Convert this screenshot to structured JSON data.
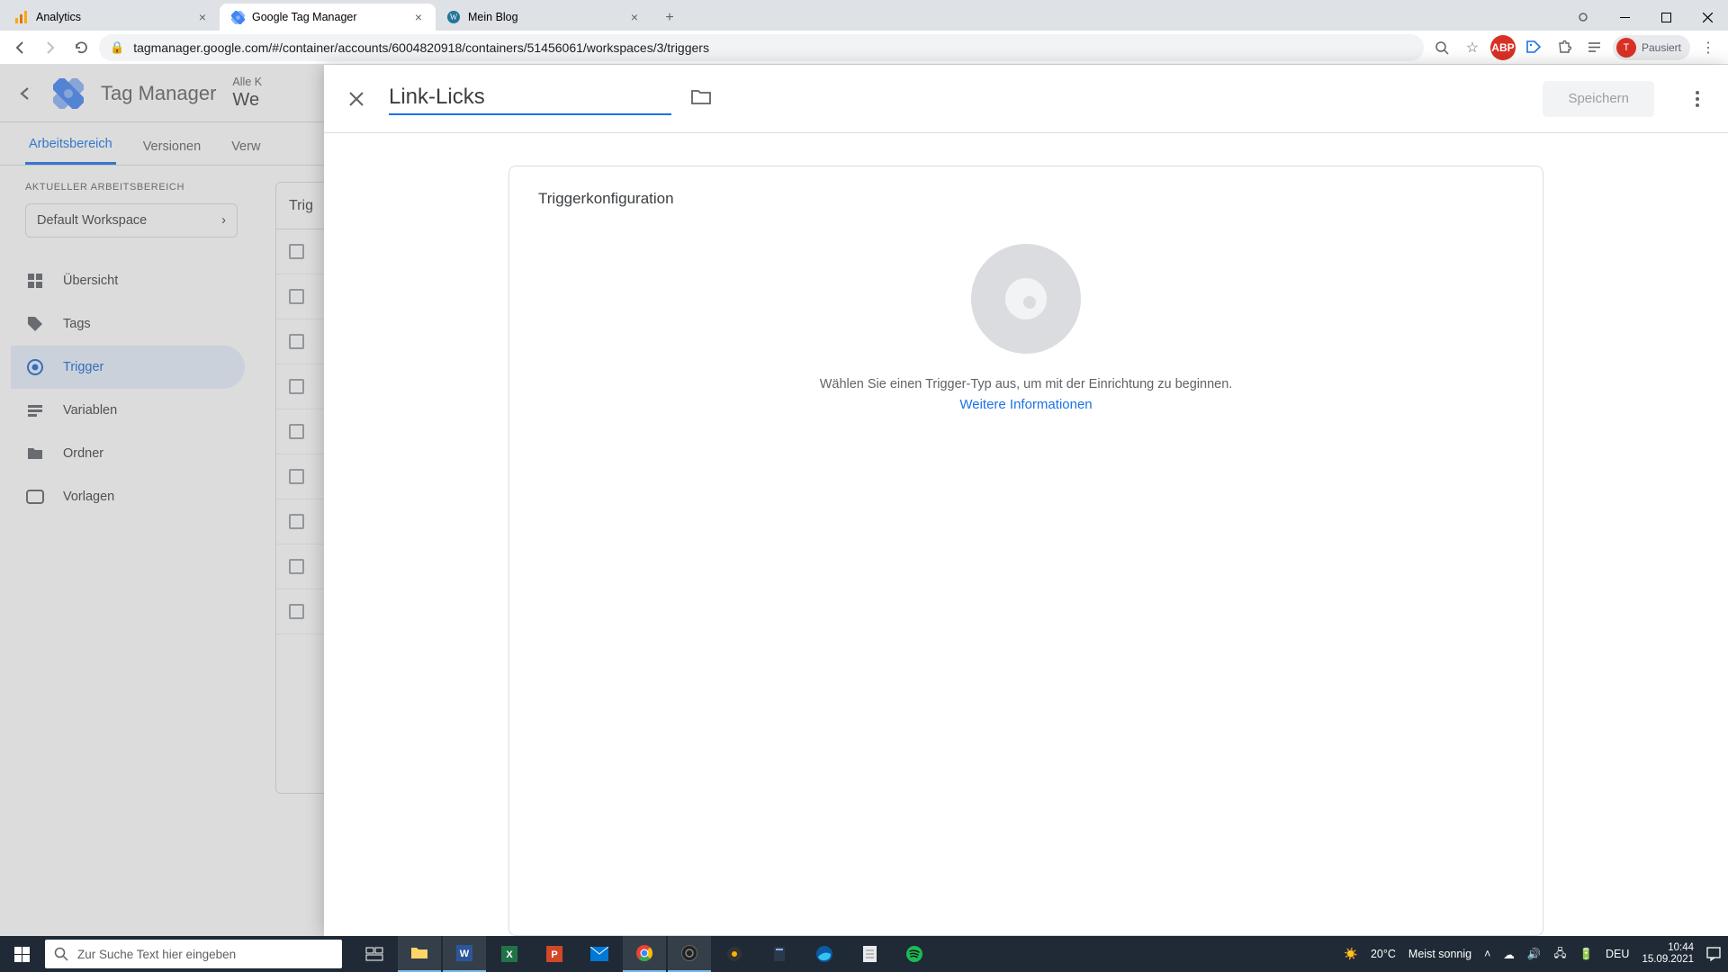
{
  "browser": {
    "tabs": [
      {
        "label": "Analytics",
        "favicon": "analytics"
      },
      {
        "label": "Google Tag Manager",
        "favicon": "gtm",
        "active": true
      },
      {
        "label": "Mein Blog",
        "favicon": "wordpress"
      }
    ],
    "url": "tagmanager.google.com/#/container/accounts/6004820918/containers/51456061/workspaces/3/triggers",
    "profile_status": "Pausiert",
    "profile_initial": "T"
  },
  "gtm": {
    "app_name": "Tag Manager",
    "crumb1": "Alle K",
    "crumb2": "We",
    "tabs": {
      "workspace": "Arbeitsbereich",
      "versions": "Versionen",
      "admin": "Verw"
    },
    "ws_label": "AKTUELLER ARBEITSBEREICH",
    "ws_name": "Default Workspace",
    "nav": {
      "overview": "Übersicht",
      "tags": "Tags",
      "trigger": "Trigger",
      "variables": "Variablen",
      "folders": "Ordner",
      "templates": "Vorlagen"
    },
    "table_head": "Trig"
  },
  "panel": {
    "title_value": "Link-Licks",
    "save": "Speichern",
    "config_title": "Triggerkonfiguration",
    "hint": "Wählen Sie einen Trigger-Typ aus, um mit der Einrichtung zu beginnen.",
    "more": "Weitere Informationen"
  },
  "taskbar": {
    "search_placeholder": "Zur Suche Text hier eingeben",
    "weather_temp": "20°C",
    "weather_label": "Meist sonnig",
    "lang": "DEU",
    "time": "10:44",
    "date": "15.09.2021"
  }
}
